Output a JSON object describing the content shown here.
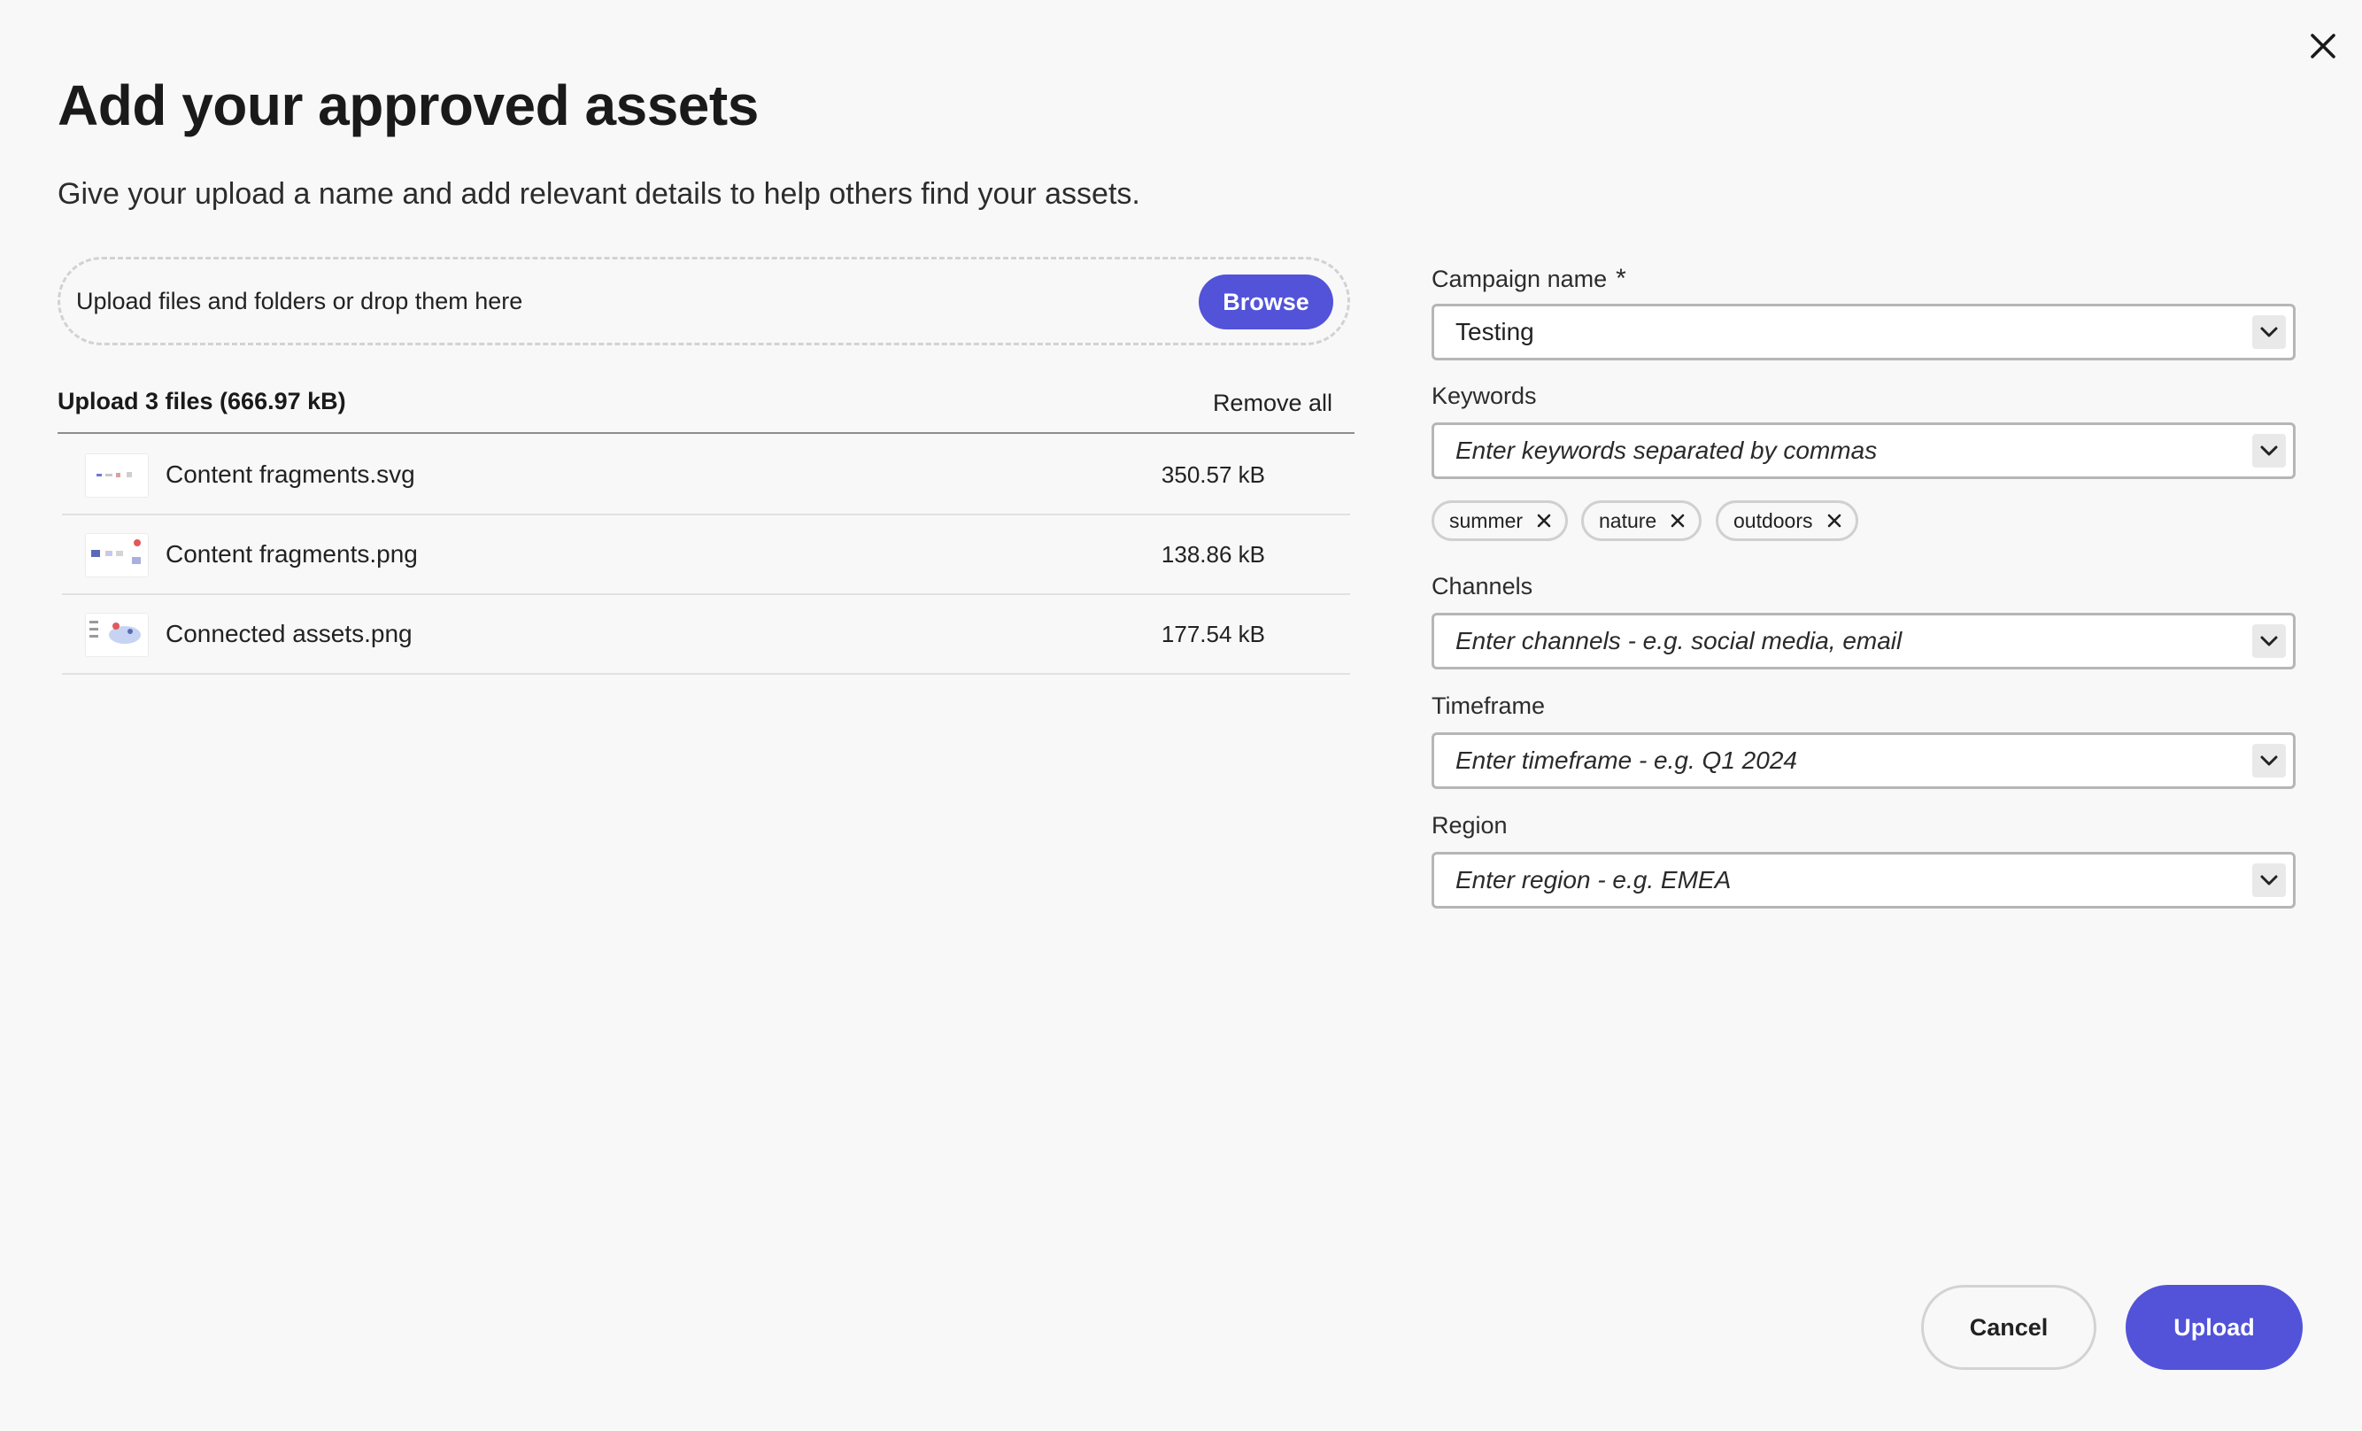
{
  "dialog": {
    "title": "Add your approved assets",
    "subtitle": "Give your upload a name and add relevant details to help others find your assets."
  },
  "dropzone": {
    "text": "Upload files and folders or drop them here",
    "browse_label": "Browse"
  },
  "file_list": {
    "title": "Upload 3 files (666.97 kB)",
    "remove_all_label": "Remove all",
    "files": [
      {
        "name": "Content fragments.svg",
        "size": "350.57 kB"
      },
      {
        "name": "Content fragments.png",
        "size": "138.86 kB"
      },
      {
        "name": "Connected assets.png",
        "size": "177.54 kB"
      }
    ]
  },
  "form": {
    "campaign": {
      "label": "Campaign name",
      "required_mark": "*",
      "value": "Testing"
    },
    "keywords": {
      "label": "Keywords",
      "placeholder": "Enter keywords separated by commas",
      "tags": [
        "summer",
        "nature",
        "outdoors"
      ]
    },
    "channels": {
      "label": "Channels",
      "placeholder": "Enter channels - e.g. social media, email"
    },
    "timeframe": {
      "label": "Timeframe",
      "placeholder": "Enter timeframe - e.g. Q1 2024"
    },
    "region": {
      "label": "Region",
      "placeholder": "Enter region - e.g. EMEA"
    }
  },
  "footer": {
    "cancel_label": "Cancel",
    "upload_label": "Upload"
  },
  "colors": {
    "accent": "#5253d9",
    "background": "#f8f8f8"
  },
  "icons": {
    "close": "close-icon",
    "chevron": "chevron-down-icon",
    "tag_remove": "tag-close-icon"
  }
}
